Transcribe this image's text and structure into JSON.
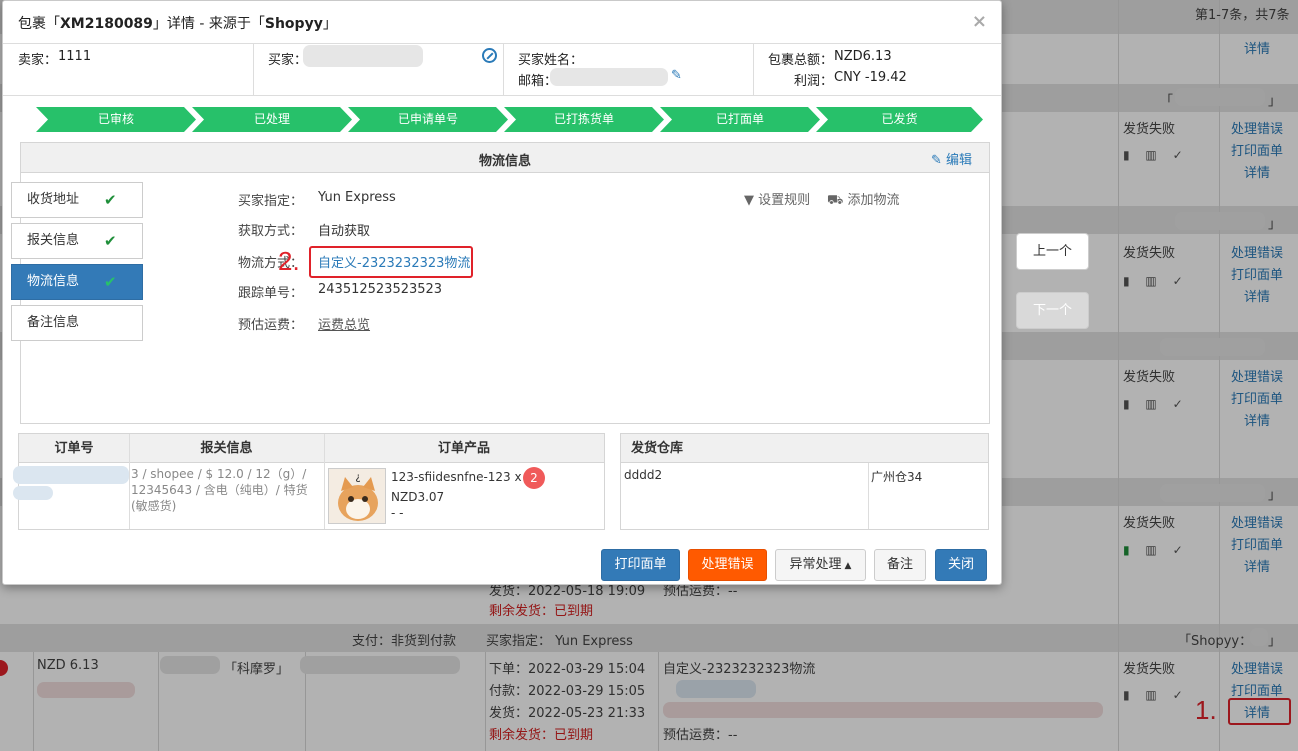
{
  "background": {
    "pagination": "第1-7条，共7条",
    "rows": [
      {
        "status": "",
        "actions": [
          "详情"
        ]
      },
      {
        "status": "发货失败",
        "actions": [
          "处理错误",
          "打印面单",
          "详情"
        ]
      },
      {
        "status": "发货失败",
        "actions": [
          "处理错误",
          "打印面单",
          "详情"
        ]
      },
      {
        "status": "发货失败",
        "actions": [
          "处理错误",
          "打印面单",
          "详情"
        ]
      },
      {
        "status": "发货失败",
        "actions": [
          "处理错误",
          "打印面单",
          "详情"
        ]
      },
      {
        "status": "发货失败",
        "actions": [
          "处理错误",
          "打印面单",
          "详情"
        ]
      }
    ],
    "row4_ship_date": "发货：2022-05-18 19:09",
    "row4_remaining_label": "剩余发货：",
    "row4_remaining_value": "已到期",
    "row4_shipping_est": "预估运费：--",
    "last_group_header": {
      "payment": "支付：非货到付款",
      "buyer_specified": "买家指定：  Yun Express",
      "shop": "「Shopyy：",
      "shop_close": "」"
    },
    "last_row": {
      "amount": "NZD 6.13",
      "name_fragment": "「科摩罗」",
      "order_time": "下单：2022-03-29 15:04",
      "pay_time": "付款：2022-03-29 15:05",
      "ship_time": "发货：2022-05-23 21:33",
      "remaining_label": "剩余发货：",
      "remaining_value": "已到期",
      "logistics": "自定义-2323232323物流",
      "shipping_est": "预估运费：--",
      "status": "发货失败",
      "actions": [
        "处理错误",
        "打印面单",
        "详情"
      ]
    },
    "bracket_open": "「",
    "bracket_close": "」",
    "annotation_1": "1."
  },
  "modal": {
    "title_prefix": "包裹「",
    "title_id": "XM2180089",
    "title_suffix": "」详情 - 来源于「",
    "title_source": "Shopyy",
    "title_end": "」",
    "close": "×",
    "seller_label": "卖家：",
    "seller_value": "1111",
    "buyer_label": "买家：",
    "buyer_name_label": "买家姓名：",
    "email_label": "邮箱：",
    "total_label": "包裹总额：",
    "total_value": "NZD6.13",
    "profit_label": "利润：",
    "profit_value": "CNY -19.42",
    "steps": [
      "已审核",
      "已处理",
      "已申请单号",
      "已打拣货单",
      "已打面单",
      "已发货"
    ],
    "panel_title": "物流信息",
    "edit_label": "编辑",
    "nav": [
      {
        "label": "收货地址",
        "check": "✔"
      },
      {
        "label": "报关信息",
        "check": "✔"
      },
      {
        "label": "物流信息",
        "check": "✔"
      },
      {
        "label": "备注信息",
        "check": ""
      }
    ],
    "fields": [
      {
        "key": "买家指定：",
        "value": "Yun Express"
      },
      {
        "key": "获取方式：",
        "value": "自动获取"
      },
      {
        "key": "物流方式：",
        "value": "自定义-2323232323物流"
      },
      {
        "key": "跟踪单号：",
        "value": "243512523523523"
      },
      {
        "key": "预估运费：",
        "value": "运费总览"
      }
    ],
    "set_rule": "设置规则",
    "add_logistics": "添加物流",
    "annotation_2": "2.",
    "order_table": {
      "headers": [
        "订单号",
        "报关信息",
        "订单产品"
      ],
      "customs_text": "3 / shopee / $ 12.0 / 12（g）/ 12345643 / 含电（纯电）/ 特货(敏感货)",
      "product_line1": "123-sfiidesnfne-123 x",
      "product_line2": "NZD3.07",
      "product_line3": "- -",
      "qty_badge": "2"
    },
    "warehouse_table": {
      "header": "发货仓库",
      "cell1": "dddd2",
      "cell2": "广州仓34"
    },
    "buttons": {
      "print": "打印面单",
      "handle_error": "处理错误",
      "exception": "异常处理",
      "note": "备注",
      "close": "关闭"
    },
    "prev": "上一个",
    "next": "下一个"
  },
  "colors": {
    "step_green": "#27c16a",
    "primary_blue": "#337ab7",
    "orange": "#ff5a00",
    "annotation_red": "#e0222a"
  }
}
